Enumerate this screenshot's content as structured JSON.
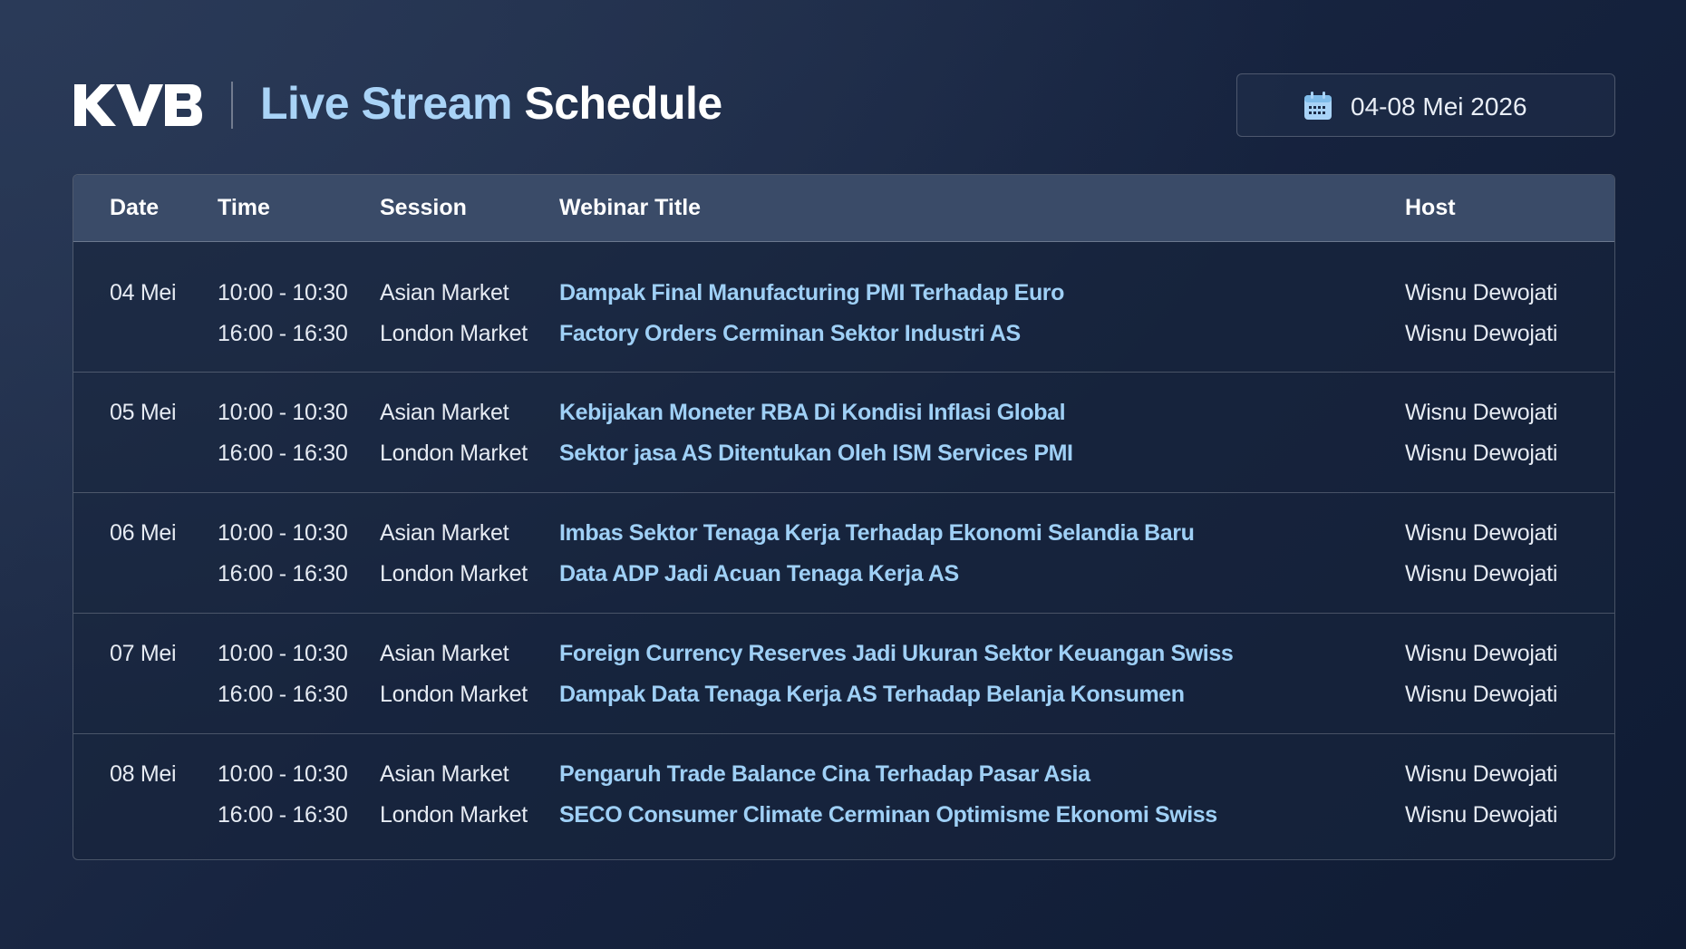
{
  "brand": {
    "logo_text": "KVB",
    "title_accent": "Live Stream",
    "title_main": "Schedule"
  },
  "date_range": {
    "icon": "calendar-icon",
    "label": "04-08 Mei 2026"
  },
  "colors": {
    "accent": "#a9d3f7",
    "title_link": "#9fd0f6",
    "header_row": "#3a4b68",
    "background": "#172440"
  },
  "table": {
    "headers": [
      "Date",
      "Time",
      "Session",
      "Webinar Title",
      "Host"
    ],
    "groups": [
      {
        "date": "04 Mei",
        "rows": [
          {
            "time": "10:00 - 10:30",
            "session": "Asian Market",
            "title": "Dampak Final Manufacturing PMI Terhadap Euro",
            "host": "Wisnu Dewojati"
          },
          {
            "time": "16:00 - 16:30",
            "session": "London Market",
            "title": "Factory Orders Cerminan Sektor Industri AS",
            "host": "Wisnu Dewojati"
          }
        ]
      },
      {
        "date": "05 Mei",
        "rows": [
          {
            "time": "10:00 - 10:30",
            "session": "Asian Market",
            "title": "Kebijakan Moneter RBA Di Kondisi Inflasi Global",
            "host": "Wisnu Dewojati"
          },
          {
            "time": "16:00 - 16:30",
            "session": "London Market",
            "title": "Sektor jasa AS Ditentukan Oleh ISM Services PMI",
            "host": "Wisnu Dewojati"
          }
        ]
      },
      {
        "date": "06 Mei",
        "rows": [
          {
            "time": "10:00 - 10:30",
            "session": "Asian Market",
            "title": "Imbas Sektor Tenaga Kerja Terhadap Ekonomi Selandia Baru",
            "host": "Wisnu Dewojati"
          },
          {
            "time": "16:00 - 16:30",
            "session": "London Market",
            "title": "Data ADP Jadi Acuan Tenaga Kerja AS",
            "host": "Wisnu Dewojati"
          }
        ]
      },
      {
        "date": "07 Mei",
        "rows": [
          {
            "time": "10:00 - 10:30",
            "session": "Asian Market",
            "title": "Foreign Currency Reserves Jadi Ukuran Sektor Keuangan Swiss",
            "host": "Wisnu Dewojati"
          },
          {
            "time": "16:00 - 16:30",
            "session": "London Market",
            "title": "Dampak Data Tenaga Kerja AS Terhadap Belanja Konsumen",
            "host": "Wisnu Dewojati"
          }
        ]
      },
      {
        "date": "08 Mei",
        "rows": [
          {
            "time": "10:00 - 10:30",
            "session": "Asian Market",
            "title": "Pengaruh Trade Balance Cina Terhadap Pasar Asia",
            "host": "Wisnu Dewojati"
          },
          {
            "time": "16:00 - 16:30",
            "session": "London Market",
            "title": "SECO Consumer Climate Cerminan Optimisme Ekonomi Swiss",
            "host": "Wisnu Dewojati"
          }
        ]
      }
    ]
  }
}
